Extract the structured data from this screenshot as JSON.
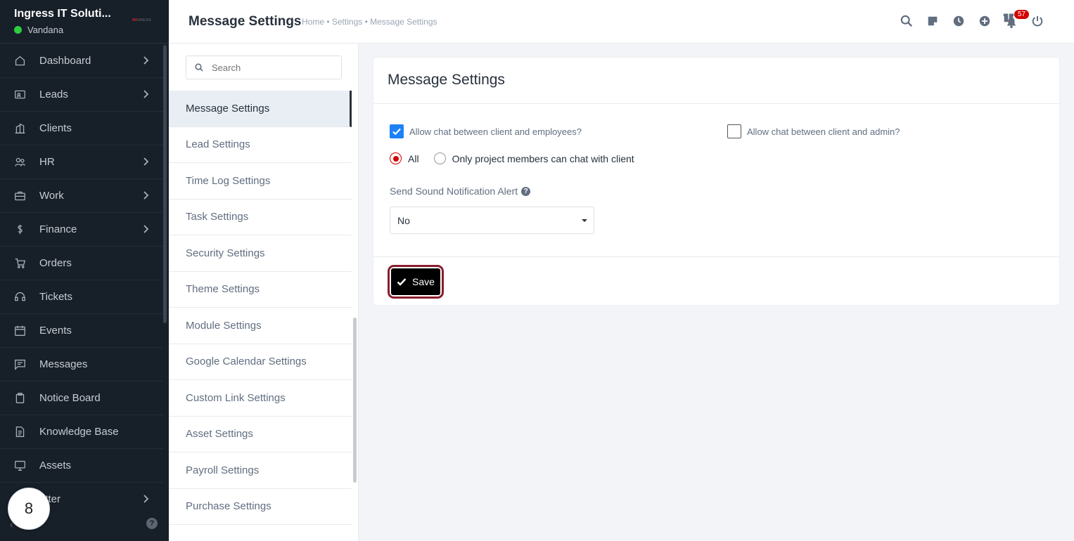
{
  "sidebar": {
    "company": "Ingress IT Soluti...",
    "user": "Vandana",
    "logo_text": "IN",
    "logo_text_rest": "GRESS",
    "items": [
      {
        "label": "Dashboard",
        "icon": "home-icon",
        "arrow": true
      },
      {
        "label": "Leads",
        "icon": "id-card-icon",
        "arrow": true
      },
      {
        "label": "Clients",
        "icon": "building-icon",
        "arrow": false
      },
      {
        "label": "HR",
        "icon": "people-icon",
        "arrow": true
      },
      {
        "label": "Work",
        "icon": "briefcase-icon",
        "arrow": true
      },
      {
        "label": "Finance",
        "icon": "dollar-icon",
        "arrow": true
      },
      {
        "label": "Orders",
        "icon": "cart-icon",
        "arrow": false
      },
      {
        "label": "Tickets",
        "icon": "headset-icon",
        "arrow": false
      },
      {
        "label": "Events",
        "icon": "calendar-icon",
        "arrow": false
      },
      {
        "label": "Messages",
        "icon": "chat-icon",
        "arrow": false
      },
      {
        "label": "Notice Board",
        "icon": "clipboard-icon",
        "arrow": false
      },
      {
        "label": "Knowledge Base",
        "icon": "document-icon",
        "arrow": false
      },
      {
        "label": "Assets",
        "icon": "monitor-icon",
        "arrow": false
      },
      {
        "label": "etter",
        "icon": "letter-icon",
        "arrow": true
      }
    ],
    "floating_badge": "8",
    "help": "?"
  },
  "header": {
    "title": "Message Settings",
    "breadcrumb": "Home • Settings • Message Settings",
    "notification_count": "57"
  },
  "settings_menu": {
    "search_placeholder": "Search",
    "items": [
      "Message Settings",
      "Lead Settings",
      "Time Log Settings",
      "Task Settings",
      "Security Settings",
      "Theme Settings",
      "Module Settings",
      "Google Calendar Settings",
      "Custom Link Settings",
      "Asset Settings",
      "Payroll Settings",
      "Purchase Settings"
    ],
    "active_index": 0
  },
  "form": {
    "card_title": "Message Settings",
    "chat_client_employees": "Allow chat between client and employees?",
    "chat_client_employees_checked": true,
    "chat_client_admin": "Allow chat between client and admin?",
    "chat_client_admin_checked": false,
    "radio_all": "All",
    "radio_project_members": "Only project members can chat with client",
    "radio_selected": "All",
    "sound_label": "Send Sound Notification Alert",
    "sound_value": "No",
    "save_label": "Save",
    "accent_color": "#1d82f5",
    "radio_color": "#d30000"
  }
}
